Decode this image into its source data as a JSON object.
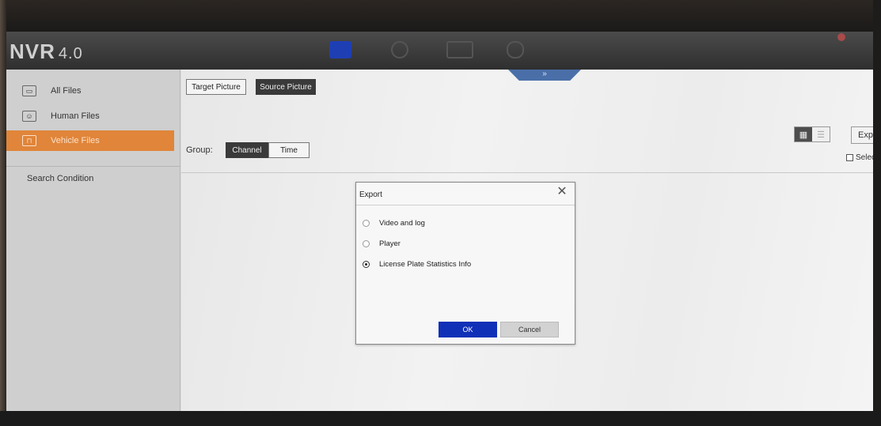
{
  "app": {
    "logo": "NVR",
    "version": "4.0"
  },
  "sidebar": {
    "items": [
      {
        "label": "All Files",
        "icon": "folder-icon"
      },
      {
        "label": "Human Files",
        "icon": "human-icon"
      },
      {
        "label": "Vehicle Files",
        "icon": "vehicle-icon"
      }
    ],
    "search_condition": "Search Condition"
  },
  "toolbar": {
    "target_picture": "Target Picture",
    "source_picture": "Source Picture",
    "group_label": "Group:",
    "channel": "Channel",
    "time": "Time",
    "export": "Expor",
    "select_all": "Select A"
  },
  "dialog": {
    "title": "Export",
    "options": [
      {
        "label": "Video and log",
        "selected": false
      },
      {
        "label": "Player",
        "selected": false
      },
      {
        "label": "License Plate Statistics Info",
        "selected": true
      }
    ],
    "ok": "OK",
    "cancel": "Cancel"
  },
  "colors": {
    "accent_orange": "#e0853a",
    "ok_blue": "#1030b8",
    "nav_active": "#1e3fb4"
  }
}
